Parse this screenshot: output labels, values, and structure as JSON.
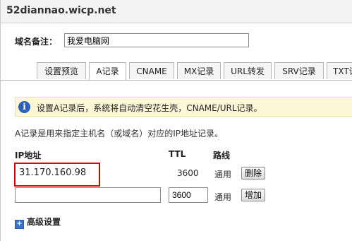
{
  "window": {
    "title": "52diannao.wicp.net"
  },
  "alias": {
    "label": "域名备注：",
    "value": "我爱电脑网"
  },
  "tabs": [
    {
      "label": "设置预览",
      "active": false
    },
    {
      "label": "A记录",
      "active": true
    },
    {
      "label": "CNAME",
      "active": false
    },
    {
      "label": "MX记录",
      "active": false
    },
    {
      "label": "URL转发",
      "active": false
    },
    {
      "label": "SRV记录",
      "active": false
    },
    {
      "label": "TXT记",
      "active": false
    }
  ],
  "notice": {
    "icon": "info-icon",
    "text": "设置A记录后，系统将自动清空花生壳，CNAME/URL记录。"
  },
  "description": "A记录是用来指定主机名（或域名）对应的IP地址记录。",
  "table": {
    "headers": {
      "ip": "IP地址",
      "ttl": "TTL",
      "line": "路线"
    },
    "rows": [
      {
        "ip": "31.170.160.98",
        "ttl": "3600",
        "line": "通用",
        "action": "删除"
      }
    ],
    "new_row": {
      "ip": "",
      "ttl": "3600",
      "line": "通用",
      "action": "增加"
    }
  },
  "advanced": {
    "icon": "plus-icon",
    "label": "高级设置"
  },
  "colors": {
    "highlight": "#e00000",
    "info_icon": "#2b62b8",
    "notice_bg": "#fdf7d8"
  }
}
